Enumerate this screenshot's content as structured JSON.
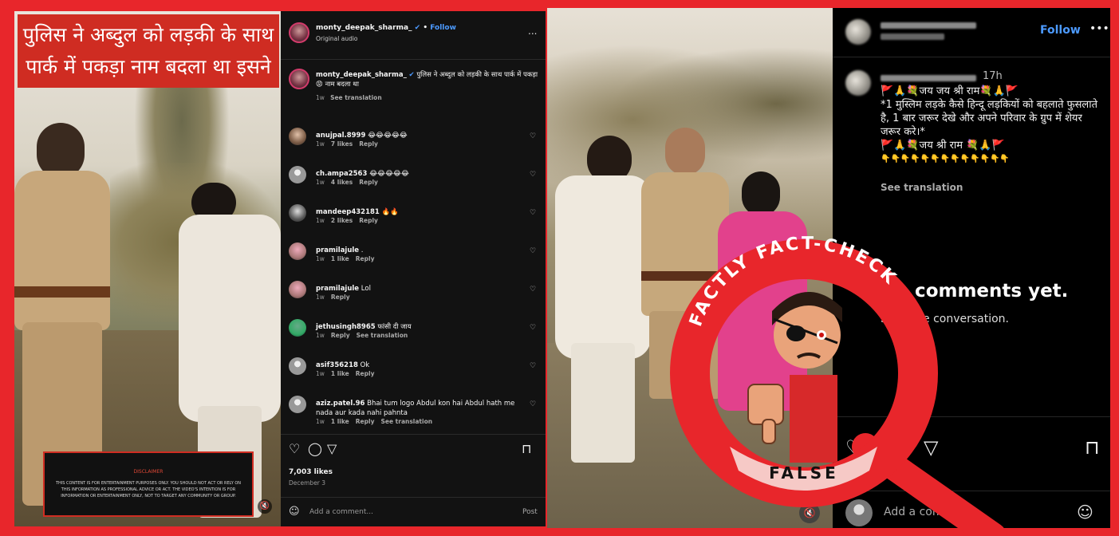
{
  "left": {
    "video": {
      "title_line1": "पुलिस ने अब्दुल को लड़की के साथ",
      "title_line2": "पार्क में पकड़ा नाम बदला था इसने",
      "disclaimer_head": "DISCLAIMER",
      "disclaimer_body": "THIS CONTENT IS FOR ENTERTAINMENT PURPOSES ONLY. YOU SHOULD NOT ACT OR RELY ON THIS INFORMATION AS PROFESSIONAL ADVICE OR ACT. THE VIDEO'S INTENTION IS FOR INFORMATION OR ENTERTAINMENT ONLY, NOT TO TARGET ANY COMMUNITY OR GROUP."
    },
    "header": {
      "username": "monty_deepak_sharma_",
      "verified": "✔",
      "dot": "•",
      "follow": "Follow",
      "audio": "Original audio",
      "more": "..."
    },
    "caption": {
      "username": "monty_deepak_sharma_",
      "text": "पुलिस ने अब्दुल को लड़की के साथ पार्क में पकड़ा 😡 नाम बदला था",
      "time": "1w",
      "translation": "See translation"
    },
    "comments": [
      {
        "user": "anujpal.8999",
        "text": "😂😂😂😂😂",
        "time": "1w",
        "likes": "7 likes",
        "reply": "Reply",
        "extra": ""
      },
      {
        "user": "ch.ampa2563",
        "text": "😂😂😂😂😂",
        "time": "1w",
        "likes": "4 likes",
        "reply": "Reply",
        "extra": ""
      },
      {
        "user": "mandeep432181",
        "text": "🔥🔥",
        "time": "1w",
        "likes": "2 likes",
        "reply": "Reply",
        "extra": ""
      },
      {
        "user": "pramilajule",
        "text": ".",
        "time": "1w",
        "likes": "1 like",
        "reply": "Reply",
        "extra": ""
      },
      {
        "user": "pramilajule",
        "text": "Lol",
        "time": "1w",
        "likes": "",
        "reply": "Reply",
        "extra": ""
      },
      {
        "user": "jethusingh8965",
        "text": "फांसी दी जाय",
        "time": "1w",
        "likes": "",
        "reply": "Reply",
        "extra": "See translation"
      },
      {
        "user": "asif356218",
        "text": "Ok",
        "time": "1w",
        "likes": "1 like",
        "reply": "Reply",
        "extra": ""
      },
      {
        "user": "aziz.patel.96",
        "text": "Bhai tum logo Abdul kon hai Abdul hath me nada aur kada nahi pahnta",
        "time": "1w",
        "likes": "1 like",
        "reply": "Reply",
        "extra": "See translation"
      }
    ],
    "footer": {
      "likes": "7,003 likes",
      "date": "December 3",
      "placeholder": "Add a comment...",
      "post": "Post"
    }
  },
  "right": {
    "header": {
      "follow": "Follow",
      "more": "•••"
    },
    "caption": {
      "time": "17h",
      "line1": "🚩🙏💐जय जय श्री राम💐🙏🚩",
      "line2": "*1 मुस्लिम लड़के कैसे हिन्दू लड़कियों को बहलाते फुसलाते है, 1 बार जरूर देखे और अपने परिवार के ग्रुप में शेयर जरूर करे।*",
      "line3": "🚩🙏💐जय श्री राम 💐🙏🚩",
      "line4": "👇👇👇👇👇👇👇👇👇👇👇👇👇",
      "translation": "See translation"
    },
    "empty": {
      "title": "No comments yet.",
      "sub": "Start the conversation."
    },
    "footer": {
      "placeholder": "Add a comment..."
    }
  },
  "stamp": {
    "arc_text": "FACTLY FACT-CHECK",
    "verdict": "FALSE",
    "ring_color": "#e8262b",
    "verdict_bg": "#f6c9c6"
  },
  "colors": {
    "frame": "#e8262b",
    "link": "#4c9aff"
  }
}
